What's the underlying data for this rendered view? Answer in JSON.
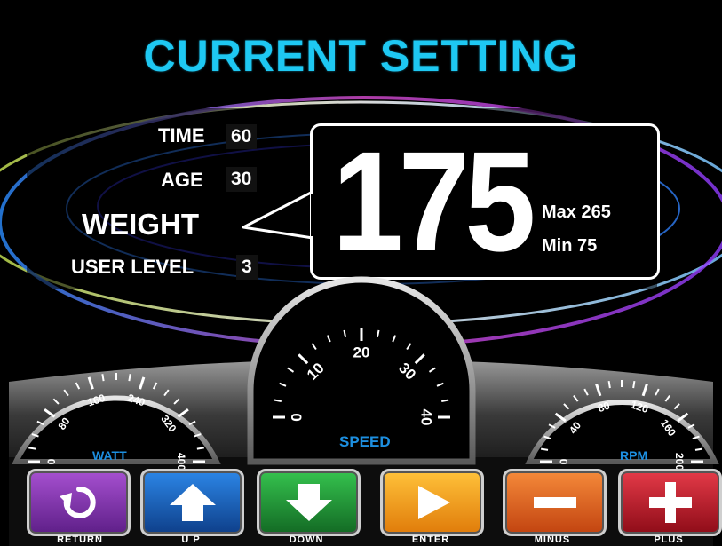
{
  "title": "CURRENT SETTING",
  "fields": {
    "time": {
      "label": "TIME",
      "value": "60"
    },
    "age": {
      "label": "AGE",
      "value": "30"
    },
    "weight": {
      "label": "WEIGHT"
    },
    "user_level": {
      "label": "USER LEVEL",
      "value": "3"
    }
  },
  "display": {
    "value": "175",
    "max": "Max 265",
    "min": "Min 75"
  },
  "gauges": {
    "watt": {
      "label": "WATT",
      "ticks": [
        "0",
        "80",
        "160",
        "240",
        "320",
        "400"
      ]
    },
    "speed": {
      "label": "SPEED",
      "ticks": [
        "0",
        "10",
        "20",
        "30",
        "40"
      ]
    },
    "rpm": {
      "label": "RPM",
      "ticks": [
        "0",
        "40",
        "80",
        "120",
        "160",
        "200"
      ]
    }
  },
  "buttons": [
    {
      "label": "RETURN",
      "icon": "return-icon",
      "color": "#7a2ea6"
    },
    {
      "label": "U P",
      "icon": "arrow-up-icon",
      "color": "#1660b8"
    },
    {
      "label": "DOWN",
      "icon": "arrow-down-icon",
      "color": "#1f9a36"
    },
    {
      "label": "ENTER",
      "icon": "play-icon",
      "color": "#f09a12"
    },
    {
      "label": "MINUS",
      "icon": "minus-icon",
      "color": "#e0621a"
    },
    {
      "label": "PLUS",
      "icon": "plus-icon",
      "color": "#c2182a"
    }
  ],
  "colors": {
    "title": "#1ec8f2",
    "gauge_label": "#1d8fe0"
  }
}
